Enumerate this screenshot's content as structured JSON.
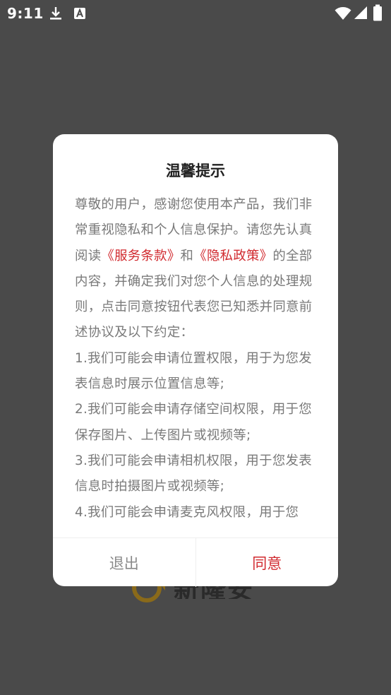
{
  "status_bar": {
    "time": "9:11",
    "icons": [
      "download-icon",
      "app-a-icon",
      "wifi-icon",
      "signal-icon",
      "battery-icon"
    ]
  },
  "background": {
    "logo_text": "新隆安"
  },
  "dialog": {
    "title": "温馨提示",
    "intro_before": "尊敬的用户，感谢您使用本产品，我们非常重视隐私和个人信息保护。请您先认真阅读",
    "terms_link": "《服务条款》",
    "and_text": "和",
    "privacy_link": "《隐私政策》",
    "intro_after": "的全部内容，并确定我们对您个人信息的处理规则，点击同意按钮代表您已知悉并同意前述协议及以下约定：",
    "items": [
      "1.我们可能会申请位置权限，用于为您发表信息时展示位置信息等;",
      "2.我们可能会申请存储空间权限，用于您保存图片、上传图片或视频等;",
      "3.我们可能会申请相机权限，用于您发表信息时拍摄图片或视频等;",
      "4.我们可能会申请麦克风权限，用于您"
    ],
    "buttons": {
      "exit_label": "退出",
      "agree_label": "同意"
    }
  },
  "colors": {
    "accent": "#d12a2f",
    "scrim": "#4a4a4a",
    "body_text": "#7a7a7a"
  }
}
